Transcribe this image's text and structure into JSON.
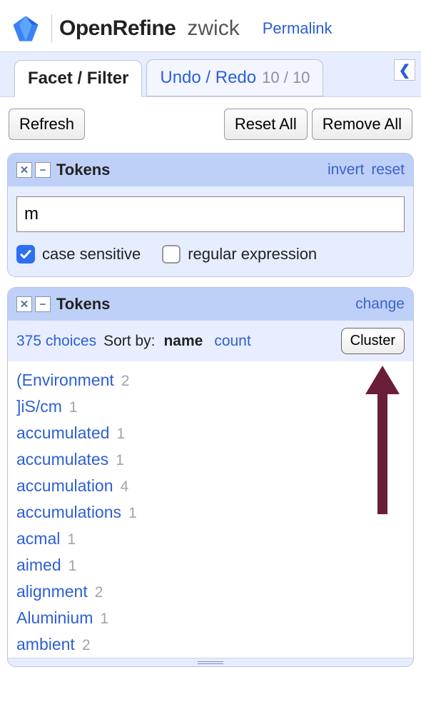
{
  "header": {
    "brand": "OpenRefine",
    "project": "zwick",
    "permalink": "Permalink"
  },
  "tabs": {
    "facet_filter": "Facet / Filter",
    "undo_redo": "Undo / Redo",
    "undo_count": "10 / 10"
  },
  "actions": {
    "refresh": "Refresh",
    "reset_all": "Reset All",
    "remove_all": "Remove All"
  },
  "text_facet": {
    "title": "Tokens",
    "invert": "invert",
    "reset": "reset",
    "search_value": "m",
    "case_sensitive_label": "case sensitive",
    "case_sensitive_checked": true,
    "regex_label": "regular expression",
    "regex_checked": false
  },
  "list_facet": {
    "title": "Tokens",
    "change": "change",
    "choices_text": "375 choices",
    "sort_by_label": "Sort by:",
    "sort_name": "name",
    "sort_count": "count",
    "cluster": "Cluster",
    "choices": [
      {
        "label": "(Environment",
        "count": "2"
      },
      {
        "label": "]iS/cm",
        "count": "1"
      },
      {
        "label": "accumulated",
        "count": "1"
      },
      {
        "label": "accumulates",
        "count": "1"
      },
      {
        "label": "accumulation",
        "count": "4"
      },
      {
        "label": "accumulations",
        "count": "1"
      },
      {
        "label": "acmal",
        "count": "1"
      },
      {
        "label": "aimed",
        "count": "1"
      },
      {
        "label": "alignment",
        "count": "2"
      },
      {
        "label": "Aluminium",
        "count": "1"
      },
      {
        "label": "ambient",
        "count": "2"
      }
    ]
  }
}
